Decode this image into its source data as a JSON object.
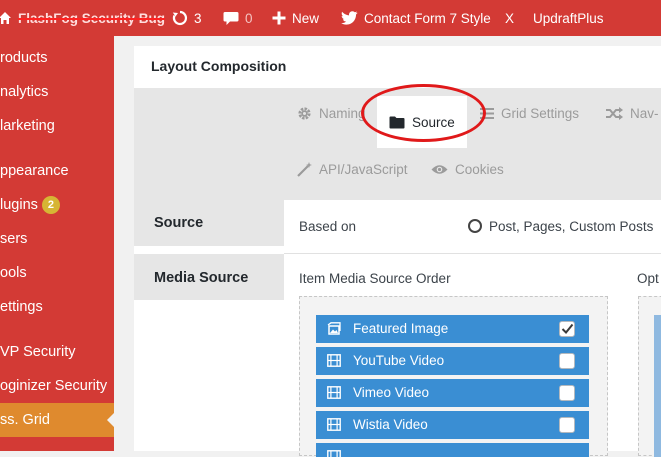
{
  "adminbar": {
    "site_name": "FlashFog Security Bug",
    "updates_count": "3",
    "comments_count": "0",
    "new_label": "New",
    "plugin1_label": "Contact Form 7 Style",
    "x_label": "X",
    "plugin2_label": "UpdraftPlus"
  },
  "sidebar": {
    "items": [
      {
        "label": "roducts"
      },
      {
        "label": "nalytics"
      },
      {
        "label": "larketing"
      },
      {
        "label": "ppearance"
      },
      {
        "label": "lugins",
        "badge": "2"
      },
      {
        "label": "sers"
      },
      {
        "label": "ools"
      },
      {
        "label": "ettings"
      },
      {
        "label": "VP Security"
      },
      {
        "label": "oginizer Security"
      },
      {
        "label": "ss. Grid"
      }
    ],
    "colors": {
      "bg": "#d33a35",
      "active": "#df8a2e"
    }
  },
  "panel": {
    "title": "Layout Composition",
    "tabs": [
      {
        "label": "Naming",
        "icon": "gear-icon"
      },
      {
        "label": "Source",
        "icon": "folder-icon"
      },
      {
        "label": "Grid Settings",
        "icon": "list-icon"
      },
      {
        "label": "Nav-",
        "icon": "shuffle-icon"
      },
      {
        "label": "API/JavaScript",
        "icon": "magic-wand-icon"
      },
      {
        "label": "Cookies",
        "icon": "eye-icon"
      }
    ],
    "source": {
      "section_label": "Source",
      "based_on_label": "Based on",
      "based_on_option": "Post, Pages, Custom Posts"
    },
    "media_source": {
      "section_label": "Media Source",
      "order_label": "Item Media Source Order",
      "opt_label": "Opt",
      "items": [
        {
          "label": "Featured Image",
          "icon": "image-icon",
          "checked": true
        },
        {
          "label": "YouTube Video",
          "icon": "film-icon",
          "checked": false
        },
        {
          "label": "Vimeo Video",
          "icon": "film-icon",
          "checked": false
        },
        {
          "label": "Wistia Video",
          "icon": "film-icon",
          "checked": false
        }
      ]
    }
  }
}
